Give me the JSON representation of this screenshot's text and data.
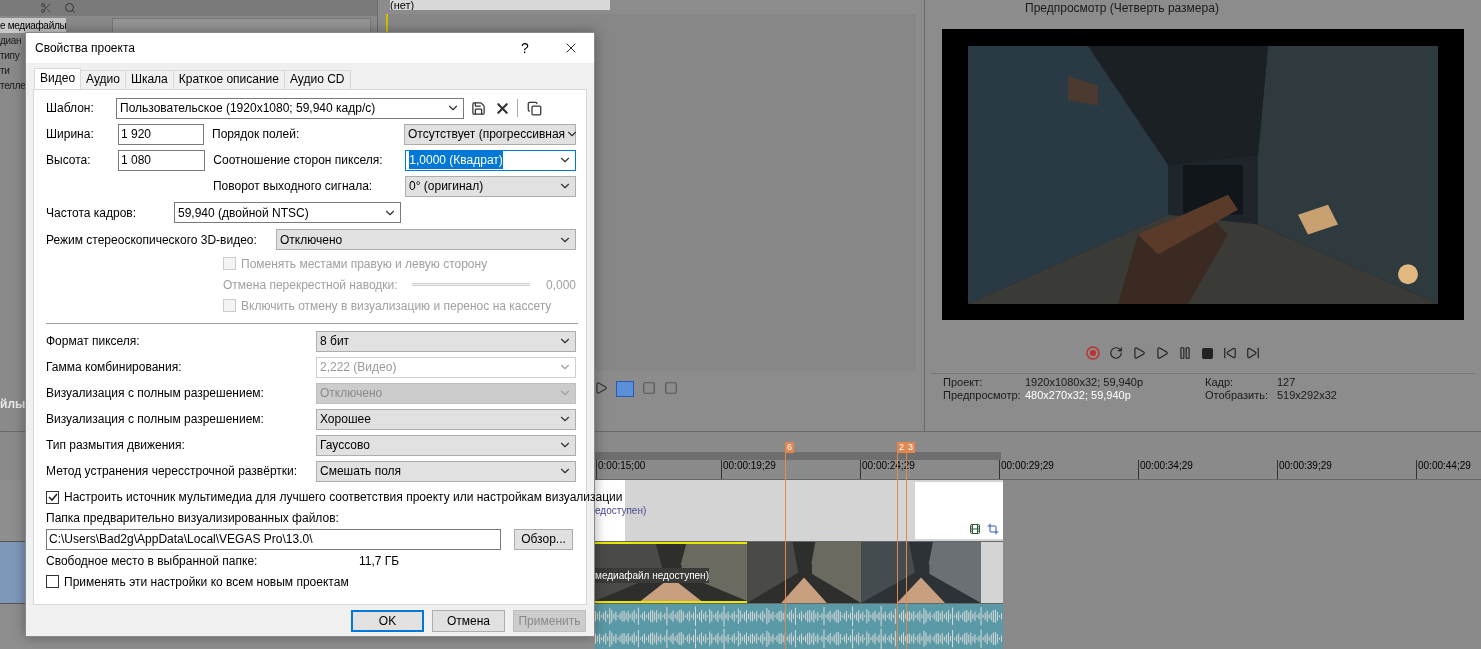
{
  "app": {
    "media_panel": {
      "items": [
        {
          "label": "е медиафайлы",
          "selected": true
        },
        {
          "label": "диан",
          "selected": false
        },
        {
          "label": "типу",
          "selected": false
        },
        {
          "label": "ти",
          "selected": false
        },
        {
          "label": "телле",
          "selected": false
        }
      ],
      "tab_label": "йлы"
    },
    "trimmer": {
      "selector": "(нет)"
    },
    "preview": {
      "quality": "Предпросмотр (Четверть размера)",
      "info": [
        {
          "label": "Проект:",
          "value": "1920x1080x32; 59,940p"
        },
        {
          "label": "Кадр:",
          "value": "127"
        },
        {
          "label": "Предпросмотр:",
          "value": "480x270x32; 59,940p"
        },
        {
          "label": "Отобразить:",
          "value": "519x292x32"
        }
      ]
    },
    "timeline": {
      "ruler": [
        "0:00:15;00",
        "00:00:19;29",
        "00:00:24;29",
        "00:00:29;29",
        "00:00:34;29",
        "00:00:39;29",
        "00:00:44;29"
      ],
      "markers": [
        {
          "label": "6"
        },
        {
          "label": "2"
        },
        {
          "label": "3"
        }
      ],
      "clips": [
        "едоступен)",
        "медиафайл недоступен)"
      ]
    }
  },
  "dialog": {
    "title": "Свойства проекта",
    "help": "?",
    "tabs": [
      {
        "label": "Видео",
        "selected": true
      },
      {
        "label": "Аудио",
        "selected": false
      },
      {
        "label": "Шкала",
        "selected": false
      },
      {
        "label": "Краткое описание",
        "selected": false
      },
      {
        "label": "Аудио CD",
        "selected": false
      }
    ],
    "template": {
      "label": "Шаблон:",
      "value": "Пользовательское (1920x1080; 59,940 кадр/с)"
    },
    "size_fields": [
      {
        "label": "Ширина:",
        "value": "1 920"
      },
      {
        "label": "Высота:",
        "value": "1 080"
      }
    ],
    "field_selects": [
      {
        "label": "Порядок полей:",
        "value": "Отсутствует (прогрессивная",
        "focused": false
      },
      {
        "label": "Соотношение сторон пикселя:",
        "value": "1,0000 (Квадрат)",
        "focused": true
      },
      {
        "label": "Поворот выходного сигнала:",
        "value": "0° (оригинал)",
        "focused": false
      }
    ],
    "frame_rate": {
      "label": "Частота кадров:",
      "value": "59,940 (двойной NTSC)"
    },
    "stereo": {
      "label": "Режим стереоскопического 3D-видео:",
      "value": "Отключено"
    },
    "stereo_options": [
      {
        "kind": "checkbox",
        "label": "Поменять местами правую и левую сторону",
        "checked": false,
        "disabled": true
      },
      {
        "kind": "slider",
        "label": "Отмена перекрестной наводки:",
        "value": "0,000",
        "disabled": true
      },
      {
        "kind": "checkbox",
        "label": "Включить отмену в визуализацию и перенос на кассету",
        "checked": false,
        "disabled": true
      }
    ],
    "render_settings": [
      {
        "label": "Формат пикселя:",
        "value": "8 бит",
        "kind": "list",
        "disabled": false
      },
      {
        "label": "Гамма комбинирования:",
        "value": "2,222 (Видео)",
        "kind": "combo",
        "disabled": true
      },
      {
        "label": "Визуализация с полным разрешением:",
        "value": "Отключено",
        "kind": "list",
        "disabled": true
      },
      {
        "label": "Визуализация с полным разрешением:",
        "value": "Хорошее",
        "kind": "list",
        "disabled": false
      },
      {
        "label": "Тип размытия движения:",
        "value": "Гауссово",
        "kind": "list",
        "disabled": false
      },
      {
        "label": "Метод устранения чересстрочной развёртки:",
        "value": "Смешать поля",
        "kind": "list",
        "disabled": false
      }
    ],
    "adapt_media": {
      "label": "Настроить источник мультимедиа для лучшего соответствия проекту или настройкам визуализации",
      "checked": true
    },
    "folder": {
      "label": "Папка предварительно визуализированных файлов:",
      "value": "C:\\Users\\Bad2g\\AppData\\Local\\VEGAS Pro\\13.0\\",
      "browse": "Обзор..."
    },
    "free_space": {
      "label": "Свободное место в выбранной папке:",
      "value": "11,7 ГБ"
    },
    "apply_all": {
      "label": "Применять эти настройки ко всем новым проектам",
      "checked": false
    },
    "buttons": [
      {
        "label": "OK",
        "kind": "default",
        "disabled": false
      },
      {
        "label": "Отмена",
        "kind": "normal",
        "disabled": false
      },
      {
        "label": "Применить",
        "kind": "normal",
        "disabled": true
      }
    ]
  }
}
